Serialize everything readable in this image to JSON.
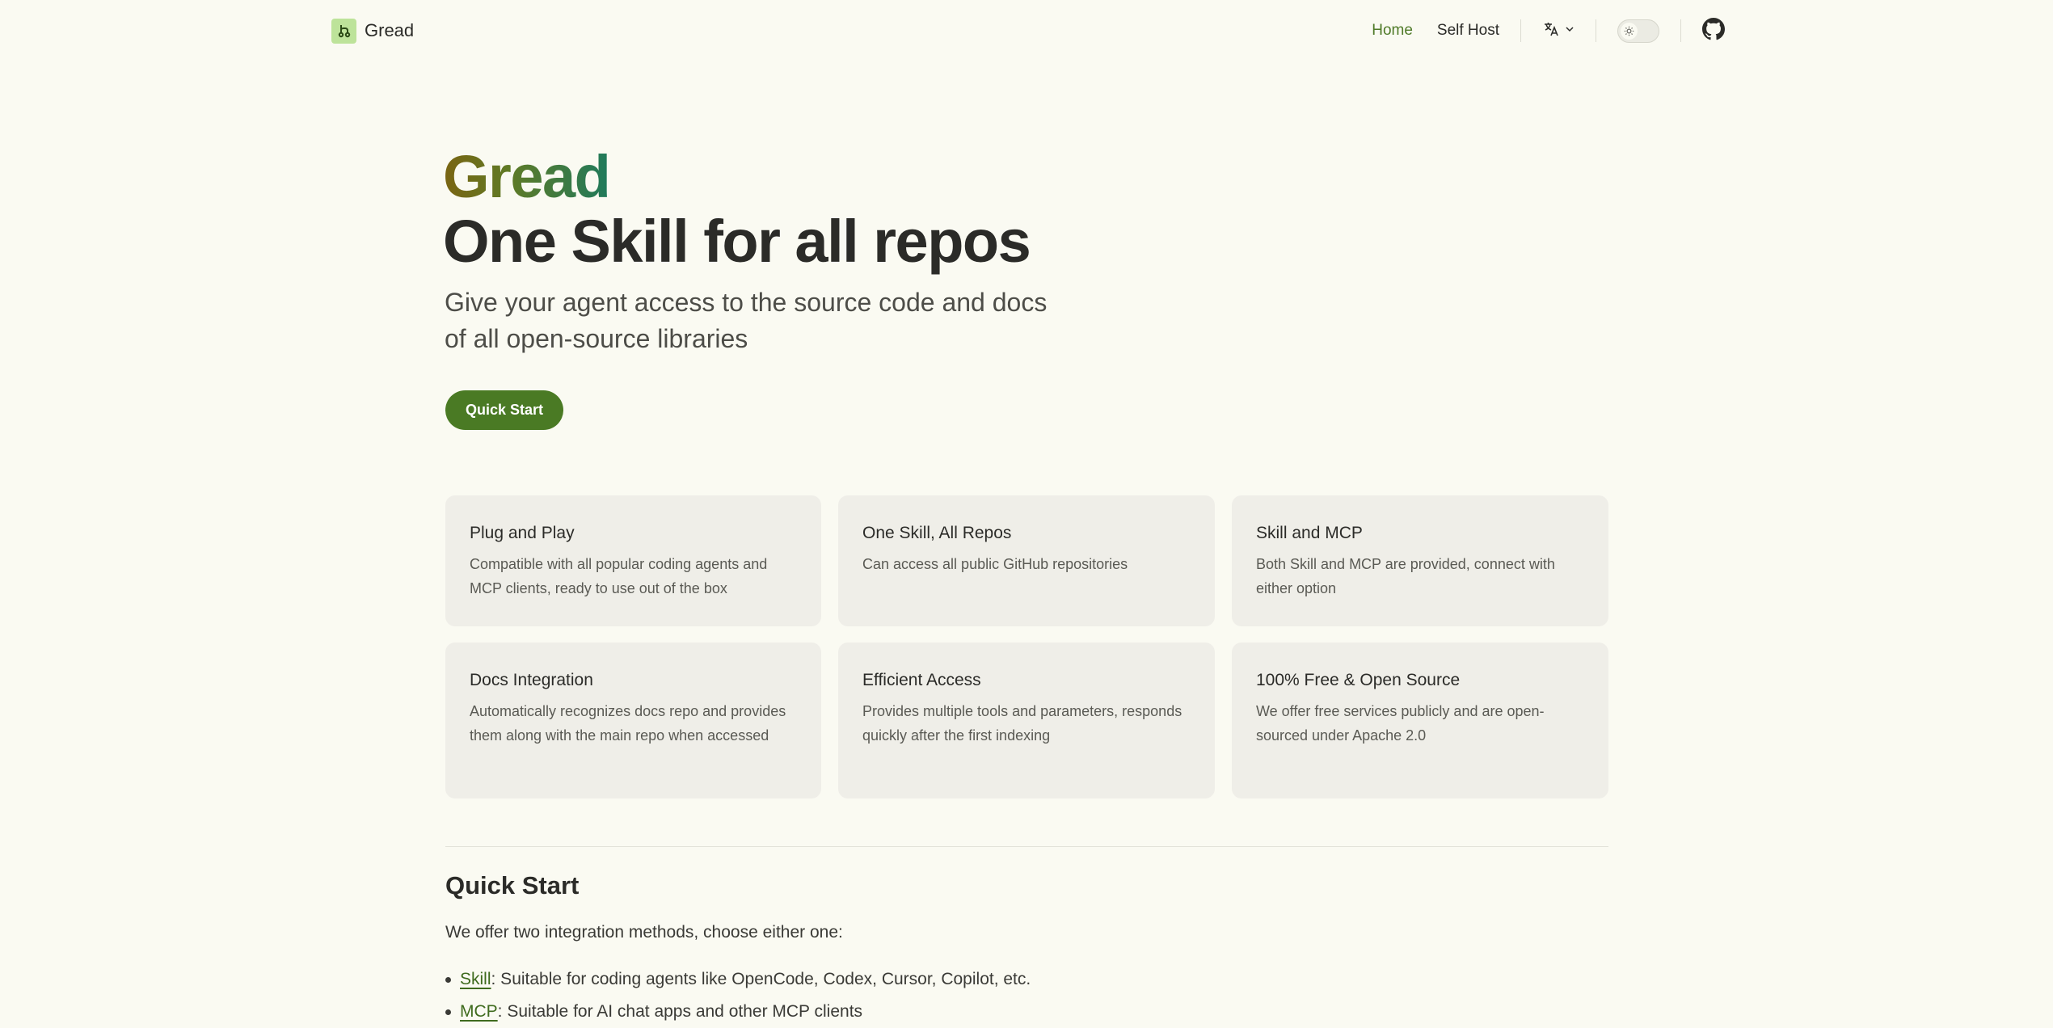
{
  "nav": {
    "brand": "Gread",
    "links": [
      "Home",
      "Self Host"
    ],
    "active": "Home"
  },
  "hero": {
    "title": "Gread",
    "subtitle": "One Skill for all repos",
    "description_line1": "Give your agent access to the source code and docs",
    "description_line2": "of all open-source libraries",
    "cta": "Quick Start"
  },
  "features": [
    {
      "title": "Plug and Play",
      "desc": "Compatible with all popular coding agents and MCP clients, ready to use out of the box"
    },
    {
      "title": "One Skill, All Repos",
      "desc": "Can access all public GitHub repositories"
    },
    {
      "title": "Skill and MCP",
      "desc": "Both Skill and MCP are provided, connect with either option"
    },
    {
      "title": "Docs Integration",
      "desc": "Automatically recognizes docs repo and provides them along with the main repo when accessed"
    },
    {
      "title": "Efficient Access",
      "desc": "Provides multiple tools and parameters, responds quickly after the first indexing"
    },
    {
      "title": "100% Free & Open Source",
      "desc": "We offer free services publicly and are open-sourced under Apache 2.0"
    }
  ],
  "quick_start": {
    "title": "Quick Start",
    "intro": "We offer two integration methods, choose either one:",
    "items": [
      {
        "link": "Skill",
        "text": ": Suitable for coding agents like OpenCode, Codex, Cursor, Copilot, etc."
      },
      {
        "link": "MCP",
        "text": ": Suitable for AI chat apps and other MCP clients"
      }
    ]
  },
  "colors": {
    "accent": "#4a7a24",
    "background": "#fafaf2",
    "card": "#efeee8",
    "logo_bg": "#bde39a"
  },
  "icons": [
    "git-branch-logo-icon",
    "translate-icon",
    "chevron-down-icon",
    "sun-icon",
    "github-icon"
  ]
}
